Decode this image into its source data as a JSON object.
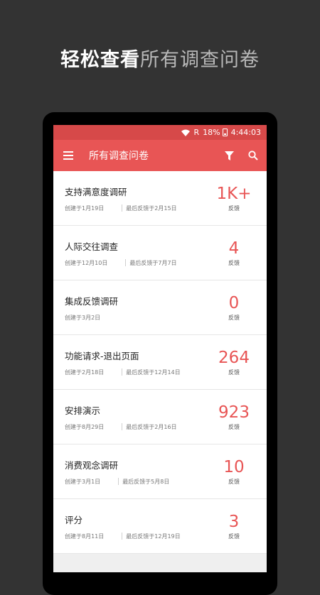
{
  "headline": {
    "strong": "轻松查看",
    "light": "所有调查问卷"
  },
  "statusbar": {
    "roaming": "R",
    "battery": "18%",
    "time": "4:44:03"
  },
  "appbar": {
    "title": "所有调查问卷"
  },
  "surveys": [
    {
      "name": "支持满意度调研",
      "created": "创建于1月19日",
      "last": "最后反馈于2月15日",
      "count": "1K+",
      "unit": "反馈"
    },
    {
      "name": "人际交往调查",
      "created": "创建于12月10日",
      "last": "最后反馈于7月7日",
      "count": "4",
      "unit": "反馈"
    },
    {
      "name": "集成反馈调研",
      "created": "创建于3月2日",
      "last": "",
      "count": "0",
      "unit": "反馈"
    },
    {
      "name": "功能请求-退出页面",
      "created": "创建于2月18日",
      "last": "最后反馈于12月14日",
      "count": "264",
      "unit": "反馈"
    },
    {
      "name": "安排演示",
      "created": "创建于8月29日",
      "last": "最后反馈于2月16日",
      "count": "923",
      "unit": "反馈"
    },
    {
      "name": "消费观念调研",
      "created": "创建于3月1日",
      "last": "最后反馈于5月8日",
      "count": "10",
      "unit": "反馈"
    },
    {
      "name": "评分",
      "created": "创建于8月11日",
      "last": "最后反馈于12月19日",
      "count": "3",
      "unit": "反馈"
    }
  ]
}
